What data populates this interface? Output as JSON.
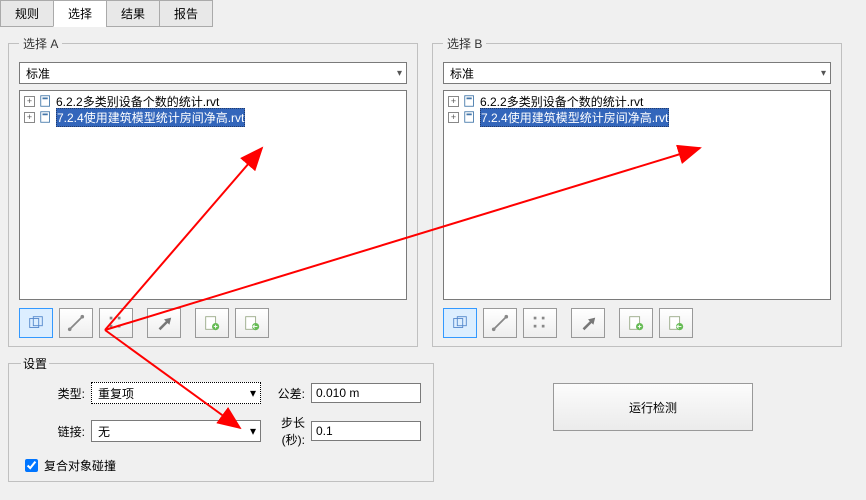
{
  "tabs": {
    "rules": "规则",
    "select": "选择",
    "results": "结果",
    "report": "报告"
  },
  "selA": {
    "legend": "选择 A",
    "combo": "标准",
    "items": [
      {
        "label": "6.2.2多类别设备个数的统计.rvt",
        "selected": false
      },
      {
        "label": "7.2.4使用建筑模型统计房间净高.rvt",
        "selected": true
      }
    ]
  },
  "selB": {
    "legend": "选择 B",
    "combo": "标准",
    "items": [
      {
        "label": "6.2.2多类别设备个数的统计.rvt",
        "selected": false
      },
      {
        "label": "7.2.4使用建筑模型统计房间净高.rvt",
        "selected": true
      }
    ]
  },
  "toolbar_icons": [
    "cube-icon",
    "line-icon",
    "dots-icon",
    "arrow-icon",
    "sheet-plus-icon",
    "sheet-back-icon"
  ],
  "settings": {
    "legend": "设置",
    "type_label": "类型:",
    "type_value": "重复项",
    "tolerance_label": "公差:",
    "tolerance_value": "0.010 m",
    "link_label": "链接:",
    "link_value": "无",
    "step_label": "步长(秒):",
    "step_value": "0.1",
    "checkbox": "复合对象碰撞"
  },
  "run_label": "运行检测"
}
